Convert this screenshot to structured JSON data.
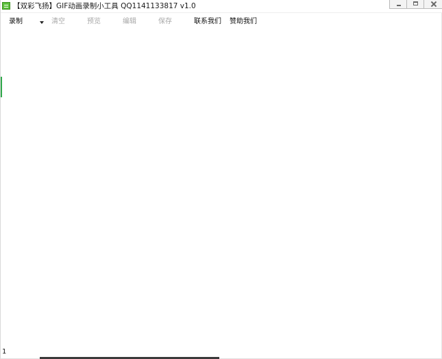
{
  "window": {
    "title": "【双彩飞扬】GIF动画录制小工具 QQ1141133817  v1.0",
    "icon": "app-icon"
  },
  "menu": {
    "record": "录制",
    "clear": "清空",
    "preview": "预览",
    "edit": "编辑",
    "save": "保存",
    "contact": "联系我们",
    "sponsor": "赞助我们"
  },
  "status": {
    "frame_count": "1"
  },
  "colors": {
    "disabled_text": "#a8a8a8",
    "enabled_text": "#111111",
    "accent": "#2fa84a"
  }
}
